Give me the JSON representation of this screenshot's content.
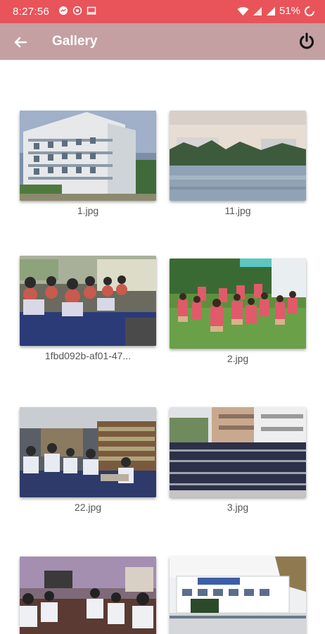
{
  "status_bar": {
    "time": "8:27:56",
    "battery": "51%",
    "left_icons": [
      "messenger-icon",
      "whatsapp-icon",
      "screen-icon"
    ],
    "right_icons": [
      "wifi-icon",
      "signal-icon",
      "signal-icon",
      "battery-icon"
    ]
  },
  "app_bar": {
    "title": "Gallery",
    "back_icon": "arrow-left-icon",
    "power_icon": "power-icon",
    "color": "#c4a0a2"
  },
  "status_color": "#e8545a",
  "gallery": {
    "items": [
      {
        "name": "1.jpg"
      },
      {
        "name": "11.jpg"
      },
      {
        "name": "1fbd092b-af01-47..."
      },
      {
        "name": "2.jpg"
      },
      {
        "name": "22.jpg"
      },
      {
        "name": "3.jpg"
      },
      {
        "name": ""
      },
      {
        "name": ""
      }
    ]
  }
}
